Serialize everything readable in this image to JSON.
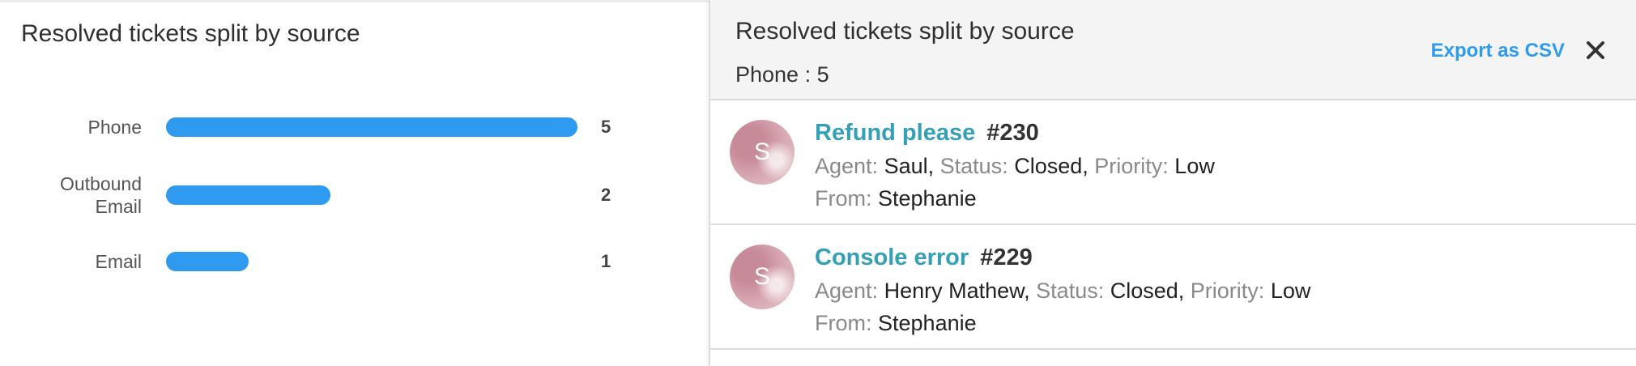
{
  "chart_data": {
    "type": "bar",
    "orientation": "horizontal",
    "title": "Resolved tickets split by source",
    "categories": [
      "Phone",
      "Outbound Email",
      "Email"
    ],
    "values": [
      5,
      2,
      1
    ],
    "xlim": [
      0,
      5
    ],
    "grid": false,
    "color": "#2e9bf0"
  },
  "drilldown": {
    "title": "Resolved tickets split by source",
    "subtitle": "Phone : 5",
    "export_label": "Export as CSV",
    "close_icon": "close-icon",
    "labels": {
      "agent": "Agent:",
      "status": "Status:",
      "priority": "Priority:",
      "from": "From:"
    },
    "tickets": [
      {
        "avatar_letter": "S",
        "subject": "Refund please",
        "number": "#230",
        "agent": "Saul",
        "status": "Closed",
        "priority": "Low",
        "from": "Stephanie"
      },
      {
        "avatar_letter": "S",
        "subject": "Console error",
        "number": "#229",
        "agent": "Henry Mathew",
        "status": "Closed",
        "priority": "Low",
        "from": "Stephanie"
      }
    ]
  },
  "colors": {
    "accent": "#2e9bf0",
    "link": "#34a0b8",
    "muted": "#8a8a8a"
  }
}
